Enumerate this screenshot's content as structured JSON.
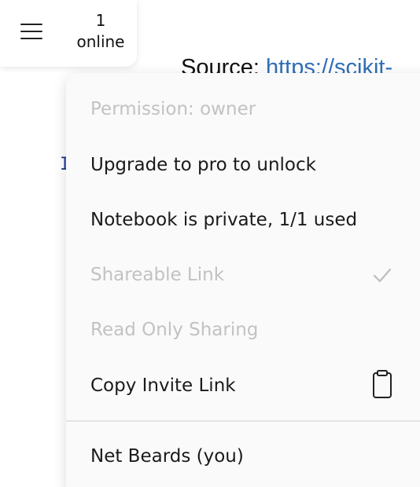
{
  "background": {
    "source_label": "Source: ",
    "source_link": "https://scikit-",
    "code_fragment": "I"
  },
  "toolbar": {
    "menu_icon": "hamburger-menu-icon",
    "online_count": "1",
    "online_label": "online"
  },
  "menu": {
    "permission": "Permission: owner",
    "upgrade": "Upgrade to pro to unlock",
    "notebook_status": "Notebook is private, 1/1 used",
    "shareable_link": "Shareable Link",
    "shareable_link_icon": "checkmark-icon",
    "read_only": "Read Only Sharing",
    "copy_invite": "Copy Invite Link",
    "copy_invite_icon": "clipboard-icon",
    "user": "Net Beards (you)"
  },
  "colors": {
    "text": "#1a1a1a",
    "disabled_text": "#c2c2c2",
    "menu_background": "#fafafa",
    "link": "#2f6fb8"
  }
}
